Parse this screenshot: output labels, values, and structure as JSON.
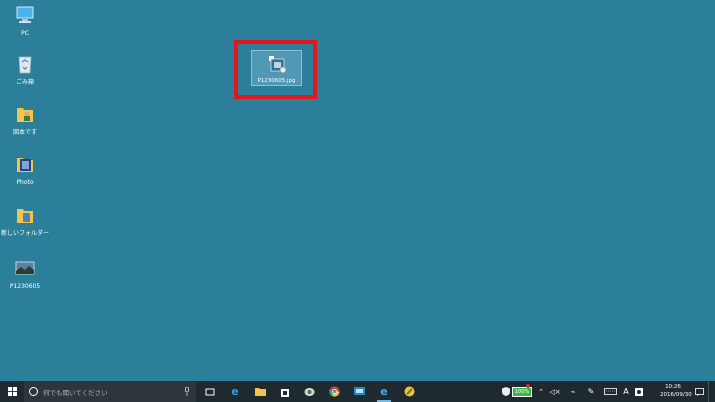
{
  "desktop": {
    "icons": [
      {
        "label": "PC",
        "icon": "pc-icon"
      },
      {
        "label": "ごみ箱",
        "icon": "recycle-bin-icon"
      },
      {
        "label": "図本です",
        "icon": "folder-person-icon"
      },
      {
        "label": "Photo",
        "icon": "photo-folder-icon"
      },
      {
        "label": "新しいフォルダー",
        "icon": "folder-icon"
      },
      {
        "label": "P1230605",
        "icon": "image-file-icon"
      }
    ],
    "selected_icon": {
      "label": "P1230605.jpg",
      "icon": "shortcut-icon"
    }
  },
  "taskbar": {
    "search_placeholder": "何でも聞いてください",
    "battery": "100%",
    "ime": "A",
    "time": "10:26",
    "date": "2016/09/30"
  },
  "colors": {
    "desktop": "#2b7f9b",
    "taskbar": "#1f2a30",
    "highlight": "#e3161b"
  }
}
